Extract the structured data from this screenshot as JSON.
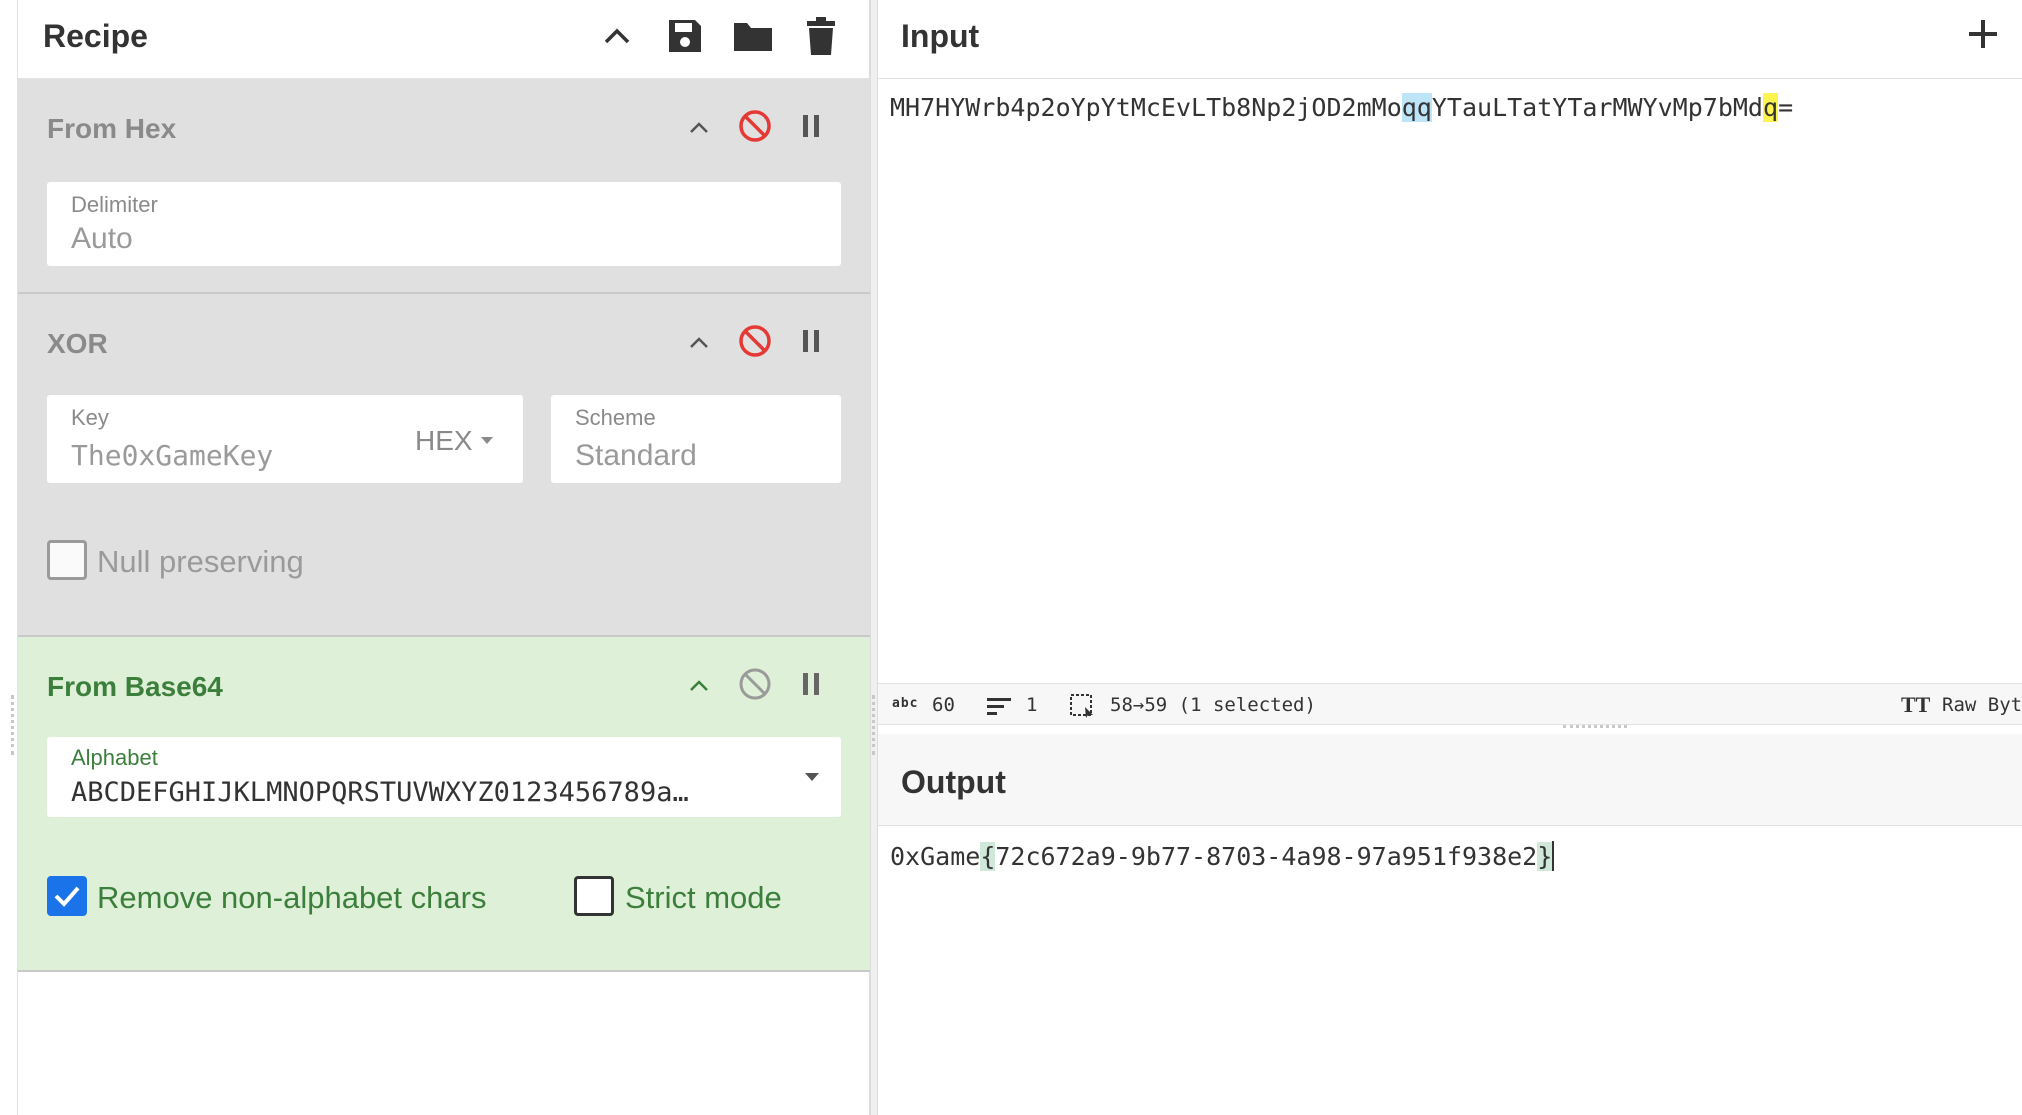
{
  "recipe": {
    "title": "Recipe",
    "operations": [
      {
        "name": "From Hex",
        "state": "disabled",
        "delimiter_label": "Delimiter",
        "delimiter_value": "Auto"
      },
      {
        "name": "XOR",
        "state": "disabled",
        "key_label": "Key",
        "key_value": "The0xGameKey",
        "key_format": "HEX",
        "scheme_label": "Scheme",
        "scheme_value": "Standard",
        "null_preserving_label": "Null preserving",
        "null_preserving_checked": false
      },
      {
        "name": "From Base64",
        "state": "active",
        "alphabet_label": "Alphabet",
        "alphabet_value": "ABCDEFGHIJKLMNOPQRSTUVWXYZ0123456789a…",
        "remove_non_alphabet_label": "Remove non-alphabet chars",
        "remove_non_alphabet_checked": true,
        "strict_mode_label": "Strict mode",
        "strict_mode_checked": false
      }
    ]
  },
  "input": {
    "title": "Input",
    "text_before": "MH7HYWrb4p2oYpYtMcEvLTb8Np2jOD2mMo",
    "text_hl_blue": "qq",
    "text_middle": "YTauLTatYTarMWYvMp7bMd",
    "text_hl_yellow": "q",
    "text_after": "=",
    "status": {
      "length_icon": "abc",
      "length": "60",
      "lines": "1",
      "selection": "58→59 (1 selected)",
      "font_icon": "TT",
      "raw_bytes": "Raw Byt"
    }
  },
  "output": {
    "title": "Output",
    "text_before": "0xGame",
    "text_brace_open": "{",
    "text_body": "72c672a9-9b77-8703-4a98-97a951f938e2",
    "text_brace_close": "}"
  },
  "colors": {
    "disabled_op_bg": "#e0e0e0",
    "active_op_bg": "#dff0d8",
    "active_op_text": "#3c7f3c",
    "disable_icon_red": "#e53935",
    "checkbox_blue": "#1a73e8"
  }
}
